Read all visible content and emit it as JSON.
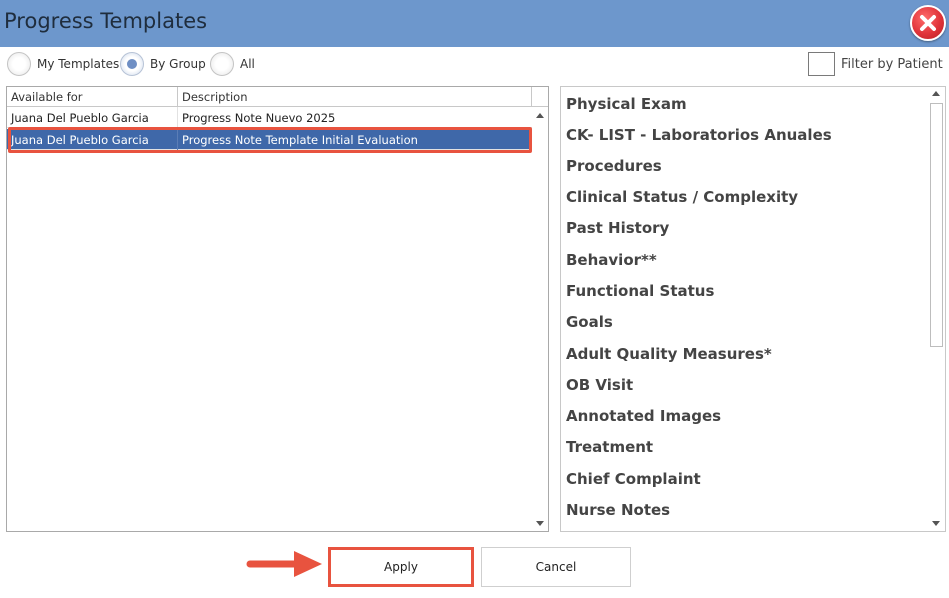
{
  "window": {
    "title": "Progress Templates"
  },
  "filters": {
    "options": [
      {
        "label": "My Templates",
        "checked": false
      },
      {
        "label": "By Group",
        "checked": true
      },
      {
        "label": "All",
        "checked": false
      }
    ],
    "filter_by_patient": {
      "label": "Filter by Patient",
      "checked": false
    }
  },
  "grid": {
    "columns": [
      "Available for",
      "Description"
    ],
    "rows": [
      {
        "available_for": "Juana Del Pueblo Garcia",
        "description": "Progress Note Nuevo 2025",
        "selected": false
      },
      {
        "available_for": "Juana Del Pueblo Garcia",
        "description": "Progress Note Template Initial Evaluation",
        "selected": true
      }
    ]
  },
  "sections": [
    "Physical Exam",
    "CK- LIST - Laboratorios Anuales",
    "Procedures",
    "Clinical Status / Complexity",
    "Past History",
    "Behavior**",
    "Functional Status",
    "Goals",
    "Adult Quality Measures*",
    "OB Visit",
    "Annotated Images",
    "Treatment",
    "Chief Complaint",
    "Nurse Notes"
  ],
  "buttons": {
    "apply": "Apply",
    "cancel": "Cancel"
  },
  "colors": {
    "titlebar": "#6d97cc",
    "selection": "#3f68a9",
    "highlight": "#e8533f"
  }
}
